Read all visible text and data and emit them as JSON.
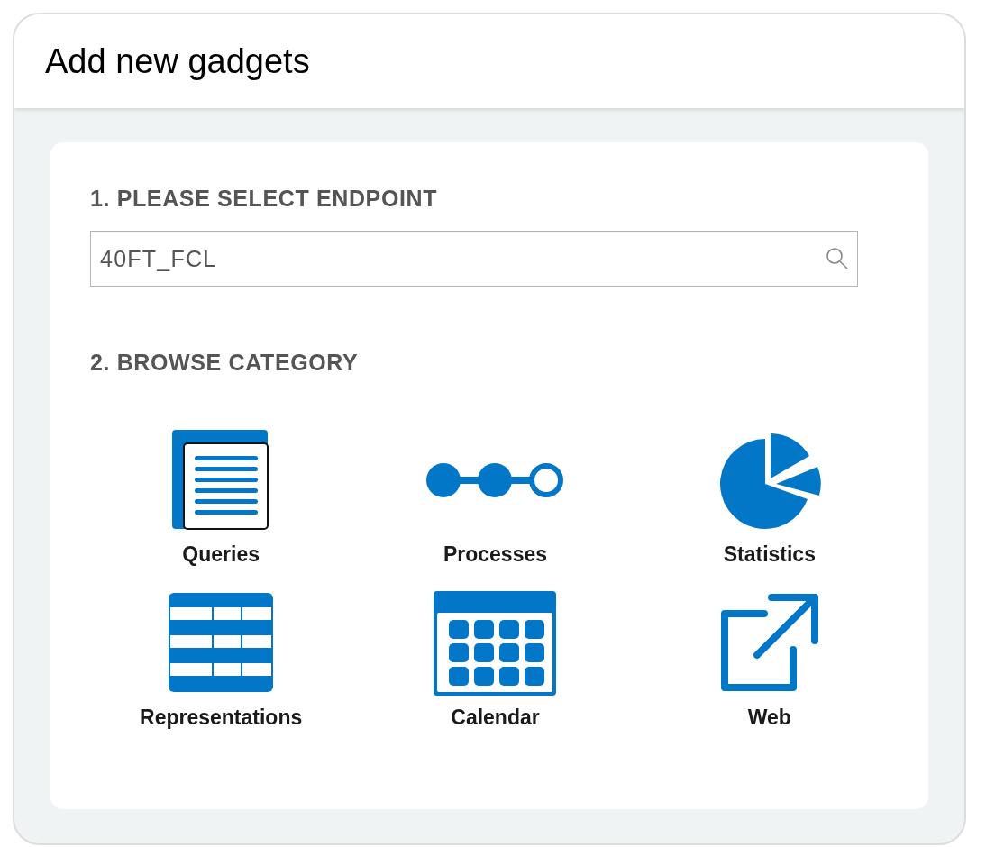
{
  "title": "Add new gadgets",
  "endpoint": {
    "label": "1. PLEASE SELECT ENDPOINT",
    "value": "40FT_FCL"
  },
  "category": {
    "label": "2. BROWSE CATEGORY",
    "items": [
      {
        "kind": "queries",
        "label": "Queries"
      },
      {
        "kind": "processes",
        "label": "Processes"
      },
      {
        "kind": "statistics",
        "label": "Statistics"
      },
      {
        "kind": "representations",
        "label": "Representations"
      },
      {
        "kind": "calendar",
        "label": "Calendar"
      },
      {
        "kind": "web",
        "label": "Web"
      }
    ]
  }
}
